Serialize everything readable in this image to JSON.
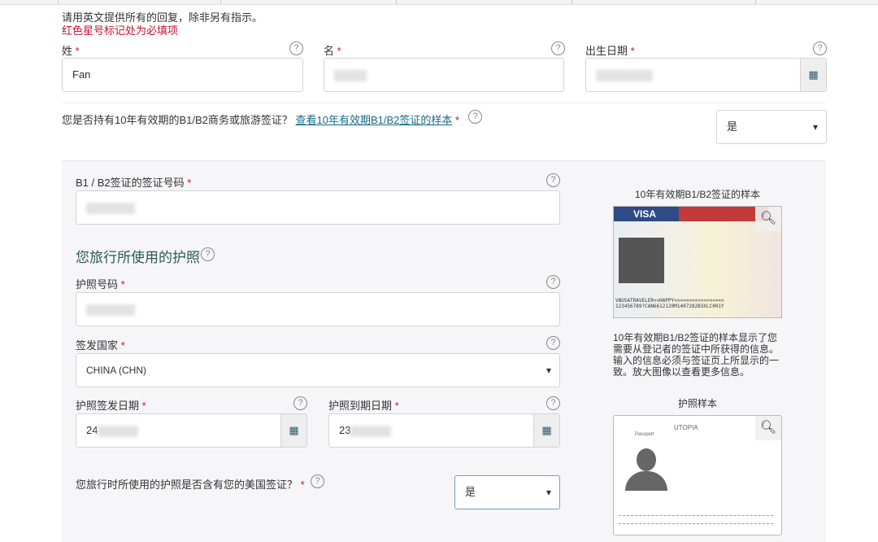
{
  "intro": "请用英文提供所有的回复，除非另有指示。",
  "required_note": "红色星号标记处为必填项",
  "surname": {
    "label": "姓",
    "value": "Fan"
  },
  "given_name": {
    "label": "名"
  },
  "dob": {
    "label": "出生日期"
  },
  "visa_question": {
    "text": "您是否持有10年有效期的B1/B2商务或旅游签证？",
    "link": "查看10年有效期B1/B2签证的样本",
    "value": "是"
  },
  "visa_number": {
    "label": "B1 / B2签证的签证号码"
  },
  "passport_section": {
    "title": "您旅行所使用的护照"
  },
  "passport_number": {
    "label": "护照号码"
  },
  "issuing_country": {
    "label": "签发国家",
    "value": "CHINA (CHN)"
  },
  "issue_date": {
    "label": "护照签发日期",
    "value": "24"
  },
  "expiry_date": {
    "label": "护照到期日期",
    "value": "23"
  },
  "contains_visa": {
    "text": "您旅行时所使用的护照是否含有您的美国签证？",
    "value": "是"
  },
  "sidebar": {
    "visa_sample_title": "10年有效期B1/B2签证的样本",
    "visa_sample_desc": "10年有效期B1/B2签证的样本显示了您需要从登记者的签证中所获得的信息。输入的信息必须与签证页上所显示的一致。放大图像以查看更多信息。",
    "passport_sample_title": "护照样本",
    "visa_img_text": "VISA",
    "visa_mrz1": "VNUSATRAVELER<<HAPPY<<<<<<<<<<<<<<<<<",
    "visa_mrz2": "123456789?CAN6612120M1407282B3XLC001Y",
    "passport_img_text": "UTOPIA",
    "passport_img_label": "Passport"
  },
  "required_mark": "*",
  "help_glyph": "?"
}
